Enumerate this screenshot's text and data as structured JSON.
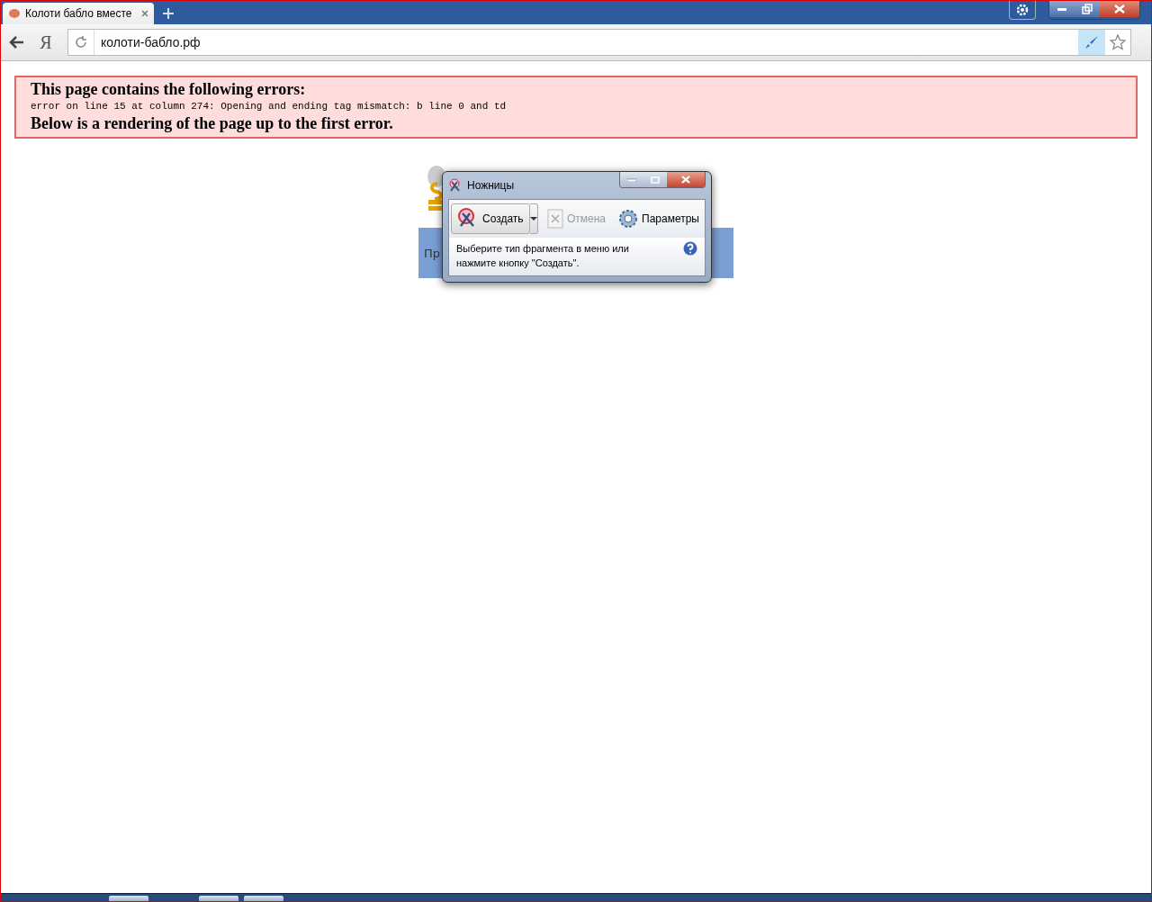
{
  "browser": {
    "tab": {
      "title": "Колоти бабло вместе",
      "selected": true
    },
    "address": "колоти-бабло.рф",
    "back_label": "Я"
  },
  "error_box": {
    "heading": "This page contains the following errors:",
    "detail": "error on line 15 at column 274: Opening and ending tag mismatch: b line 0 and td",
    "footer": "Below is a rendering of the page up to the first error."
  },
  "page": {
    "banner_text": "Пр"
  },
  "snipping_tool": {
    "title": "Ножницы",
    "buttons": [
      {
        "label": "Создать",
        "disabled": false,
        "kind": "new"
      },
      {
        "label": "Отмена",
        "disabled": true,
        "kind": "cancel"
      },
      {
        "label": "Параметры",
        "disabled": false,
        "kind": "options"
      }
    ],
    "message": "Выберите тип фрагмента в меню или нажмите кнопку \"Создать\"."
  }
}
